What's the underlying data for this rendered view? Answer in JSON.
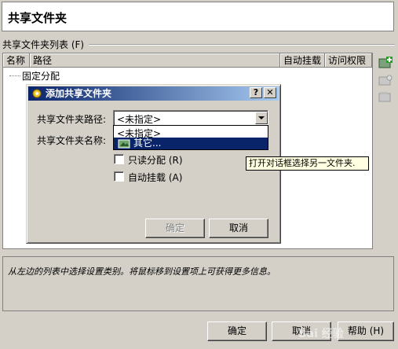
{
  "header": {
    "title": "共享文件夹"
  },
  "folder_list": {
    "group_label": "共享文件夹列表 (F)",
    "columns": [
      "名称",
      "路径",
      "自动挂载",
      "访问权限"
    ],
    "tree_row": "固定分配"
  },
  "side_toolbar": [
    "add-share-icon",
    "edit-share-icon",
    "remove-share-icon"
  ],
  "description": "从左边的列表中选择设置类别。将鼠标移到设置项上可获得更多信息。",
  "buttons": {
    "ok": "确定",
    "cancel": "取消",
    "help": "帮助 (H)"
  },
  "dialog": {
    "title": "添加共享文件夹",
    "title_buttons": {
      "help": "?",
      "close": "✕"
    },
    "path_label": "共享文件夹路径:",
    "path_value": "<未指定>",
    "dropdown_options": [
      "<未指定>",
      "其它..."
    ],
    "selected_option": "其它...",
    "name_label": "共享文件夹名称:",
    "readonly_label": "只读分配 (R)",
    "readonly_checked": false,
    "automount_label": "自动挂载 (A)",
    "automount_checked": false,
    "ok": "确定",
    "cancel": "取消"
  },
  "tooltip": "打开对话框选择另一文件夹.",
  "watermark": "Bai 经验",
  "colors": {
    "title_bar_start": "#0a246a",
    "title_bar_end": "#a6caf0",
    "selection": "#0a246a",
    "tooltip_bg": "#ffffe1"
  }
}
